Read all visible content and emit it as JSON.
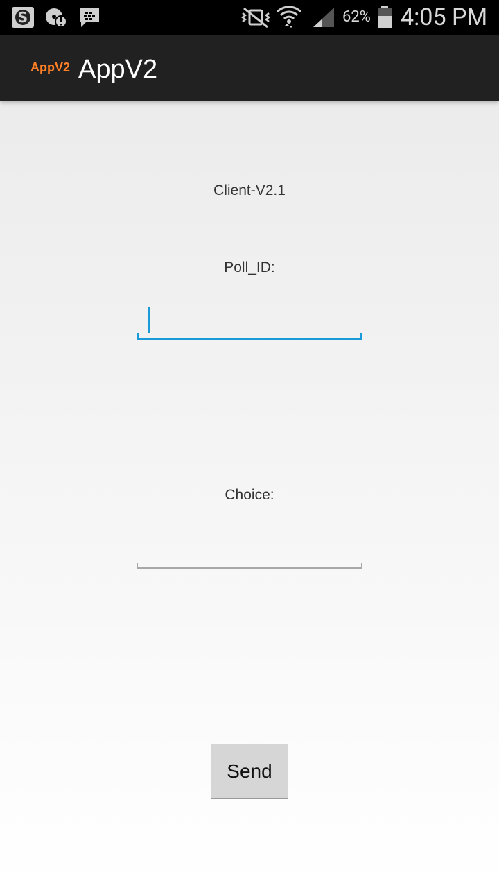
{
  "status_bar": {
    "battery_percent": "62%",
    "time": "4:05 PM",
    "icons": [
      "swiftkey-icon",
      "disc-alert-icon",
      "bbm-icon",
      "mute-vibrate-icon",
      "wifi-icon",
      "signal-icon",
      "battery-icon"
    ]
  },
  "action_bar": {
    "logo_text": "AppV2",
    "title": "AppV2"
  },
  "main": {
    "version_label": "Client-V2.1",
    "poll_id_label": "Poll_ID:",
    "poll_id_value": "",
    "choice_label": "Choice:",
    "choice_value": "",
    "send_label": "Send"
  },
  "colors": {
    "accent": "#1a9ad8",
    "logo": "#ff7f27",
    "action_bar": "#212121"
  }
}
